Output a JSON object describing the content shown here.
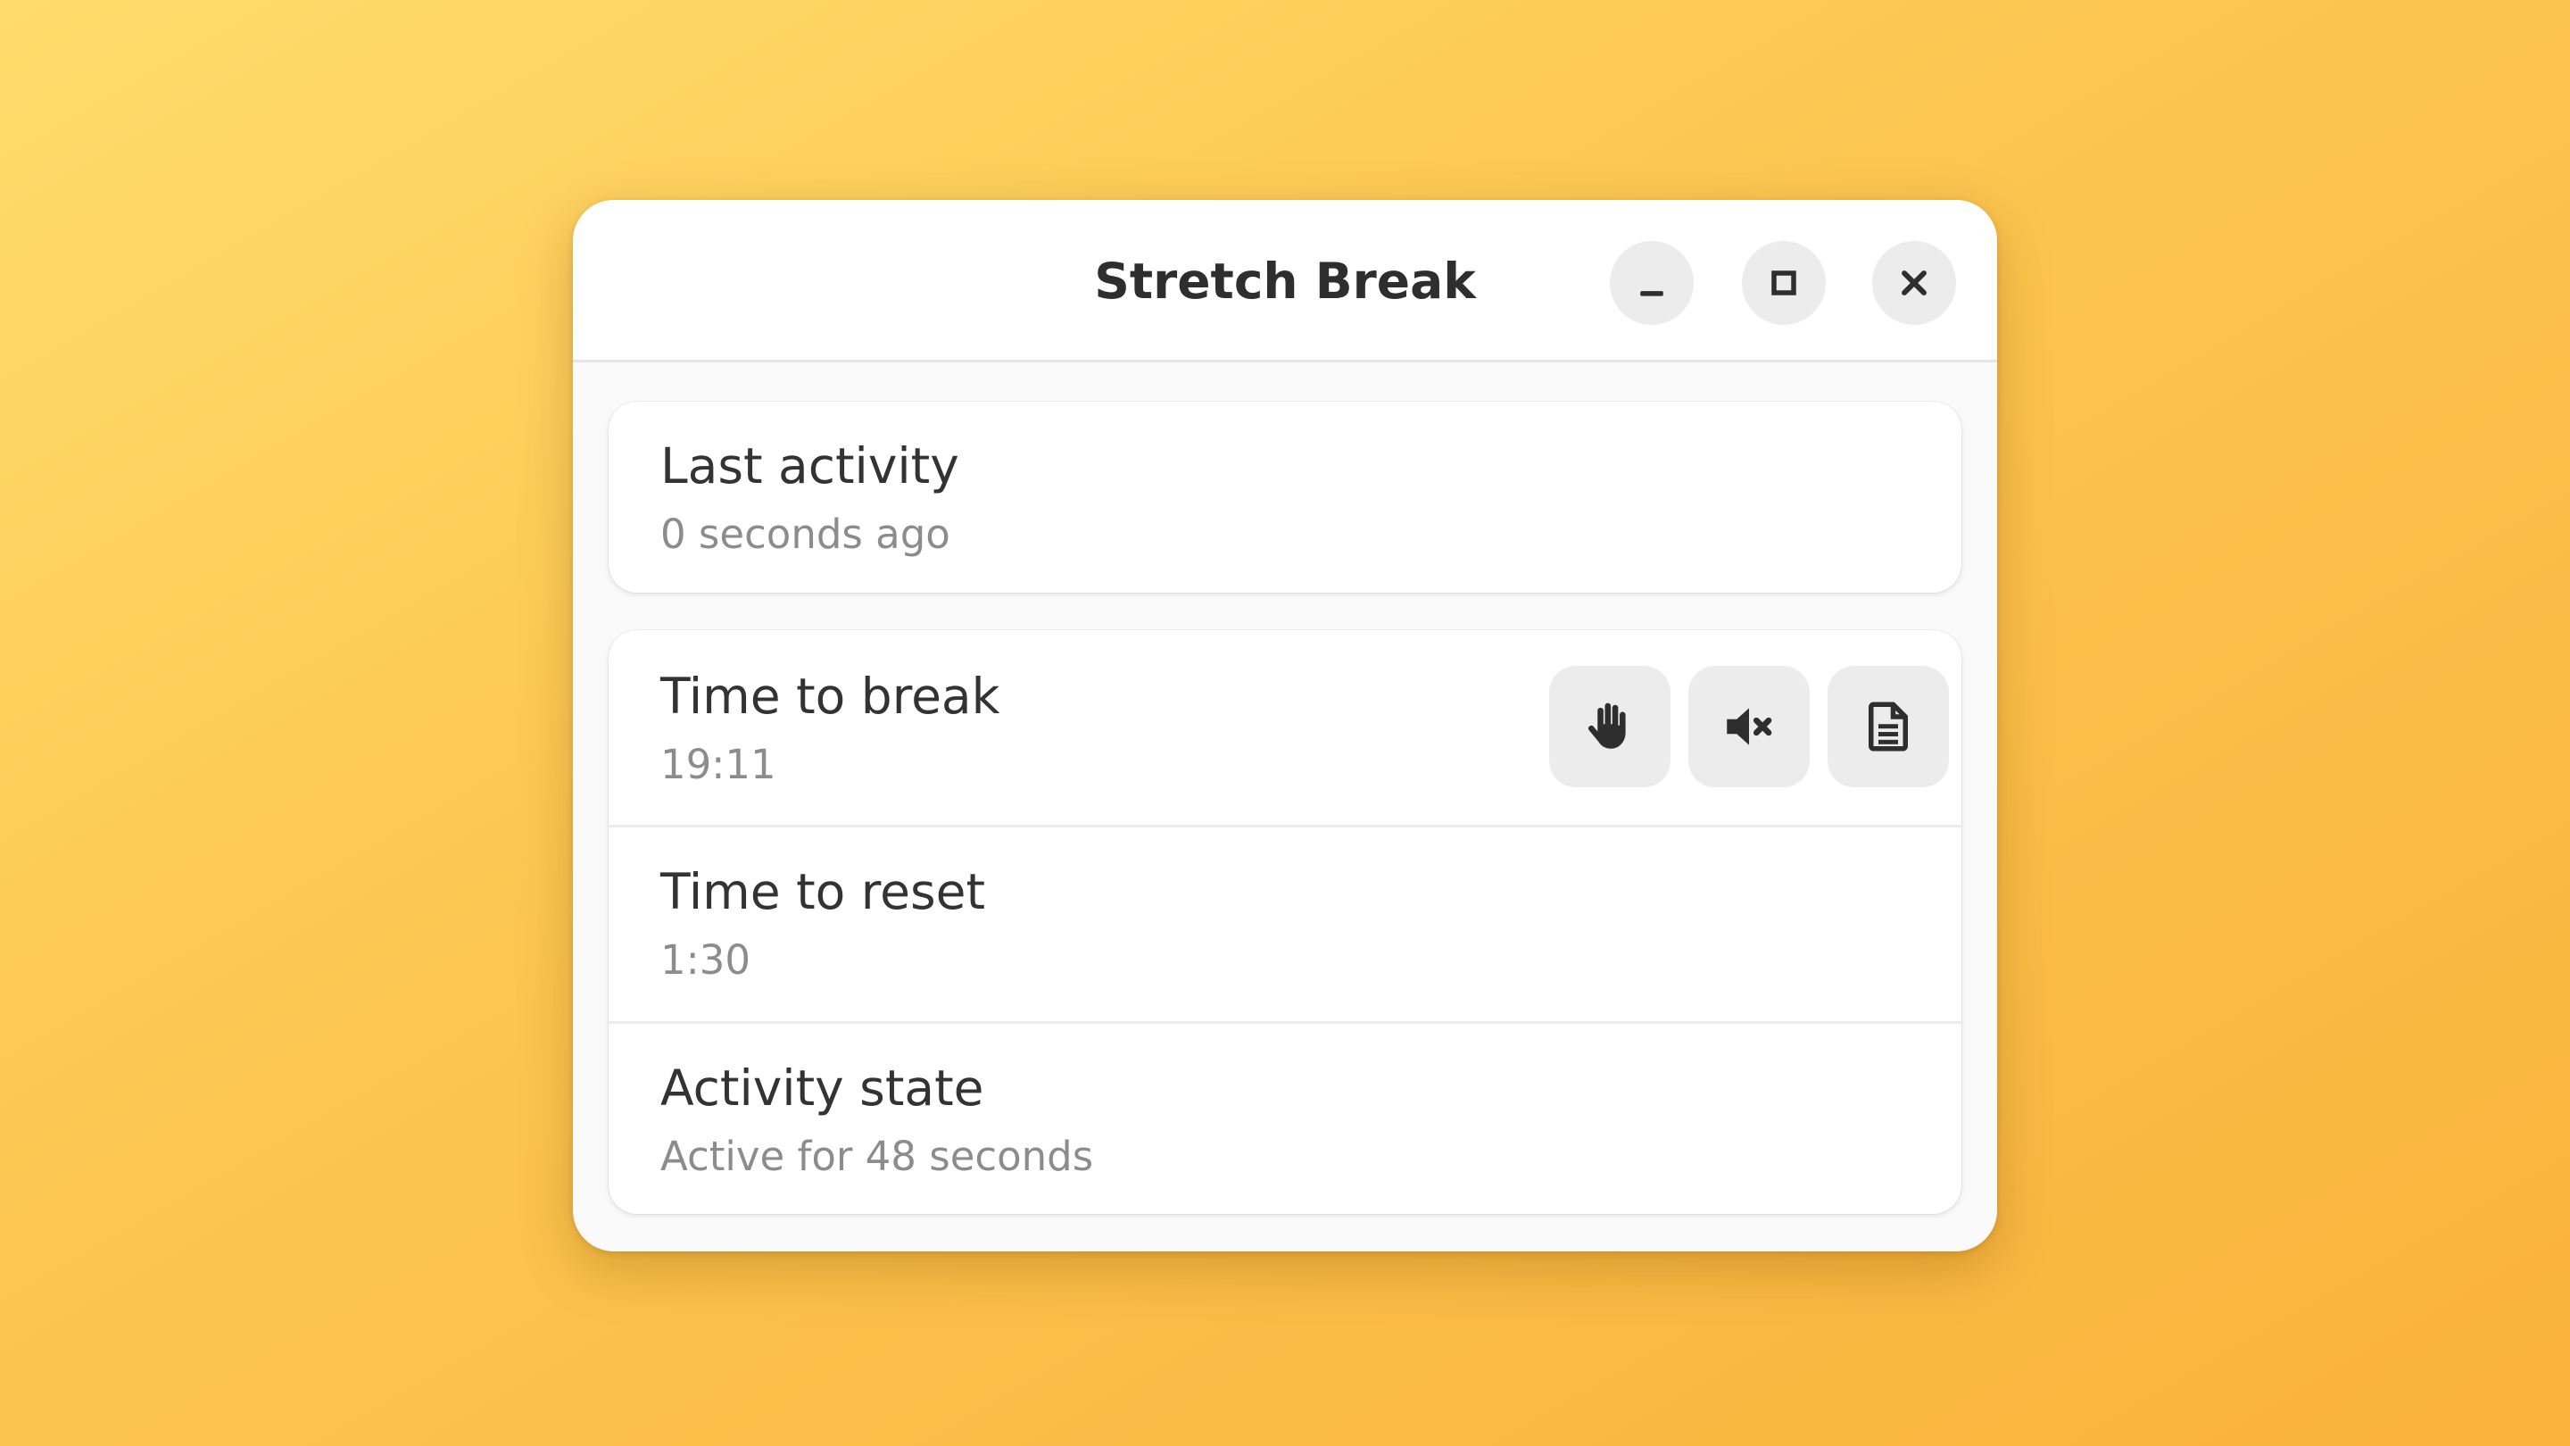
{
  "window": {
    "title": "Stretch Break",
    "controls": {
      "minimize": "minimize-icon",
      "maximize": "maximize-icon",
      "close": "close-icon"
    }
  },
  "last_activity": {
    "label": "Last activity",
    "value": "0 seconds ago"
  },
  "timers": {
    "time_to_break": {
      "label": "Time to break",
      "value": "19:11",
      "actions": [
        "hand-icon",
        "mute-icon",
        "document-icon"
      ]
    },
    "time_to_reset": {
      "label": "Time to reset",
      "value": "1:30"
    },
    "activity_state": {
      "label": "Activity state",
      "value": "Active for 48 seconds"
    }
  },
  "colors": {
    "background_top": "#ffdc6c",
    "background_bottom": "#f9b23b",
    "window_bg": "#fafafa",
    "card_bg": "#ffffff",
    "button_bg": "#ececec",
    "title_text": "#2e2e2e",
    "secondary_text": "#8c8c8c"
  }
}
